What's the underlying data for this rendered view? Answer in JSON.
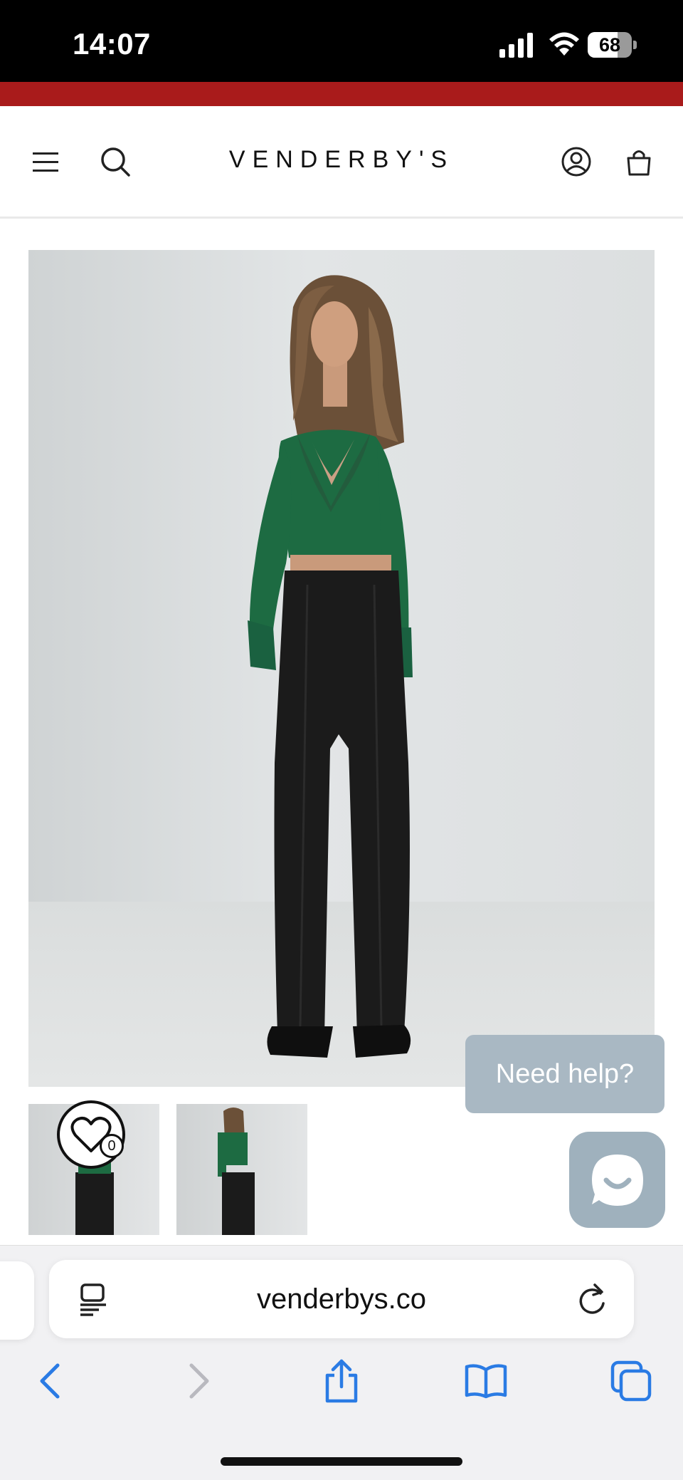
{
  "status_bar": {
    "time": "14:07",
    "battery_level": "68",
    "battery_fraction": 0.68
  },
  "colors": {
    "promo_bar": "#a91b1b",
    "top_green": "#1d6b42",
    "pants_black": "#1b1b1b",
    "help_bubble": "#a9b8c3",
    "safari_blue": "#2a7be4"
  },
  "header": {
    "logo": "VENDERBY'S",
    "icons": [
      "menu-icon",
      "search-icon",
      "account-icon",
      "cart-icon"
    ]
  },
  "gallery": {
    "wishlist_count": "0"
  },
  "support": {
    "help_label": "Need help?"
  },
  "browser": {
    "url": "venderbys.co",
    "toolbar_icons": [
      "back-icon",
      "forward-icon",
      "share-icon",
      "bookmarks-icon",
      "tabs-icon"
    ]
  }
}
